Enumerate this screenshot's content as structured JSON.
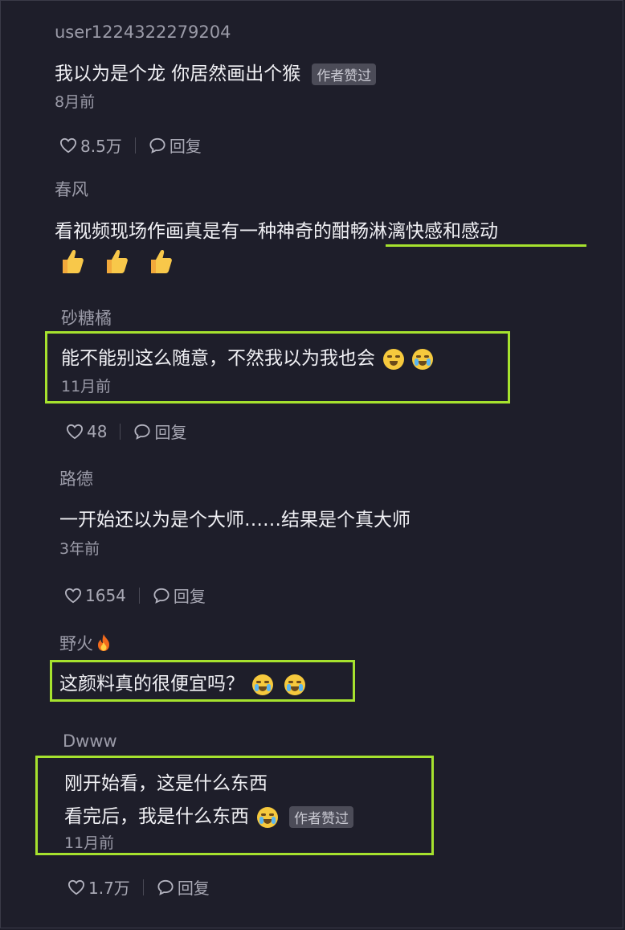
{
  "comments": [
    {
      "user": "user1224322279204",
      "text": "我以为是个龙 你居然画出个猴",
      "badge": "作者赞过",
      "time": "8月前",
      "likes": "8.5万",
      "reply": "回复"
    },
    {
      "user": "春风",
      "text": "看视频现场作画真是有一种神奇的酣畅淋漓快感和感动"
    },
    {
      "user": "砂糖橘",
      "text": "能不能别这么随意，不然我以为我也会",
      "time": "11月前",
      "likes": "48",
      "reply": "回复"
    },
    {
      "user": "路德",
      "text": "一开始还以为是个大师……结果是个真大师",
      "time": "3年前",
      "likes": "1654",
      "reply": "回复"
    },
    {
      "user": "野火",
      "text": "这颜料真的很便宜吗？"
    },
    {
      "user": "Dwww",
      "line1": "刚开始看，这是什么东西",
      "line2": "看完后，我是什么东西",
      "badge": "作者赞过",
      "time": "11月前",
      "likes": "1.7万",
      "reply": "回复"
    }
  ],
  "icons": {
    "like": "heart-outline-icon",
    "reply": "speech-bubble-icon",
    "emoji": "face-emoji-icon",
    "thumbs": "thumbs-up-emoji",
    "fire": "fire-emoji"
  },
  "colors": {
    "background": "#1e1e2a",
    "highlight": "#a6e22e"
  }
}
